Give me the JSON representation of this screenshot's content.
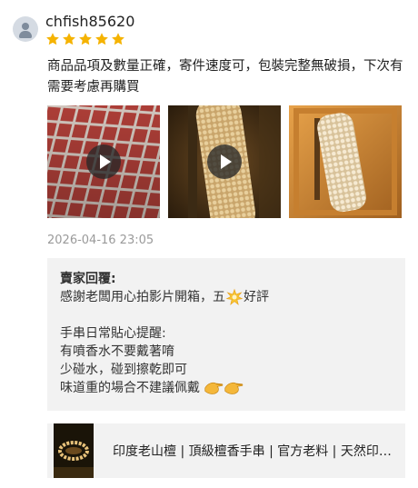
{
  "review": {
    "username": "chfish85620",
    "rating": 5,
    "text": "商品品項及數量正確，寄件速度可，包裝完整無破損，下次有需要考慮再購買",
    "media": [
      {
        "type": "video",
        "icon": "play-icon"
      },
      {
        "type": "video",
        "icon": "play-icon"
      },
      {
        "type": "image"
      }
    ],
    "timestamp": "2026-04-16 23:05"
  },
  "seller_reply": {
    "title": "賣家回覆:",
    "line1_before": "感謝老闆用心拍影片開箱，五",
    "line1_after": "好評",
    "tip_title": "手串日常貼心提醒:",
    "tip1": "有噴香水不要戴著唷",
    "tip2": "少碰水，碰到擦乾即可",
    "tip3": "味道重的場合不建議佩戴"
  },
  "product": {
    "name": "印度老山檀 | 頂級檀香手串 | 官方老料 | 天然印度老山檀香手串"
  },
  "colors": {
    "star": "#f5b301",
    "reply_bg": "#f2f2f2",
    "timestamp": "#9a9a9a"
  }
}
